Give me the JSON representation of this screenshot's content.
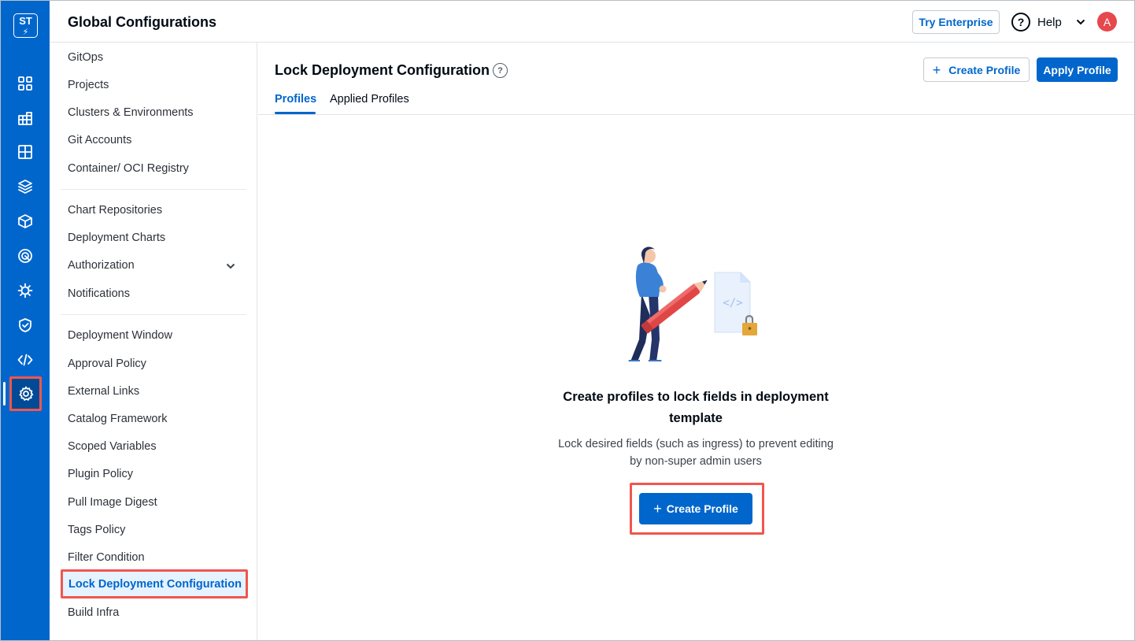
{
  "rail": {
    "logo_text": "ST",
    "icons": [
      "apps-grid-icon",
      "dashboard-icon",
      "table-icon",
      "stack-icon",
      "package-icon",
      "security-scan-icon",
      "bug-icon",
      "shield-check-icon",
      "code-icon"
    ],
    "active_icon": "settings-gear-icon"
  },
  "header": {
    "title": "Global Configurations",
    "try_enterprise": "Try Enterprise",
    "help_icon": "?",
    "help_label": "Help",
    "avatar_initial": "A"
  },
  "sidebar": {
    "group1": [
      "GitOps",
      "Projects",
      "Clusters & Environments",
      "Git Accounts",
      "Container/ OCI Registry"
    ],
    "group2": [
      "Chart Repositories",
      "Deployment Charts",
      "Authorization",
      "Notifications"
    ],
    "group3": [
      "Deployment Window",
      "Approval Policy",
      "External Links",
      "Catalog Framework",
      "Scoped Variables",
      "Plugin Policy",
      "Pull Image Digest",
      "Tags Policy",
      "Filter Condition"
    ],
    "selected": "Lock Deployment Configuration",
    "after_selected": "Build Infra"
  },
  "main": {
    "title": "Lock Deployment Configuration",
    "title_help": "?",
    "tabs": [
      {
        "label": "Profiles",
        "active": true
      },
      {
        "label": "Applied Profiles",
        "active": false
      }
    ],
    "create_profile": "Create Profile",
    "apply_profile": "Apply Profile",
    "plus": "+"
  },
  "empty_state": {
    "title": "Create profiles to lock fields in deployment template",
    "subtitle": "Lock desired fields (such as ingress) to prevent editing by non-super admin users",
    "cta": "Create Profile",
    "cta_plus": "+",
    "file_code_glyph": "</>"
  },
  "colors": {
    "brand": "#0066cc",
    "highlight": "#f0564e",
    "avatar": "#e5484d",
    "selected_bg": "#e5f2ff"
  }
}
